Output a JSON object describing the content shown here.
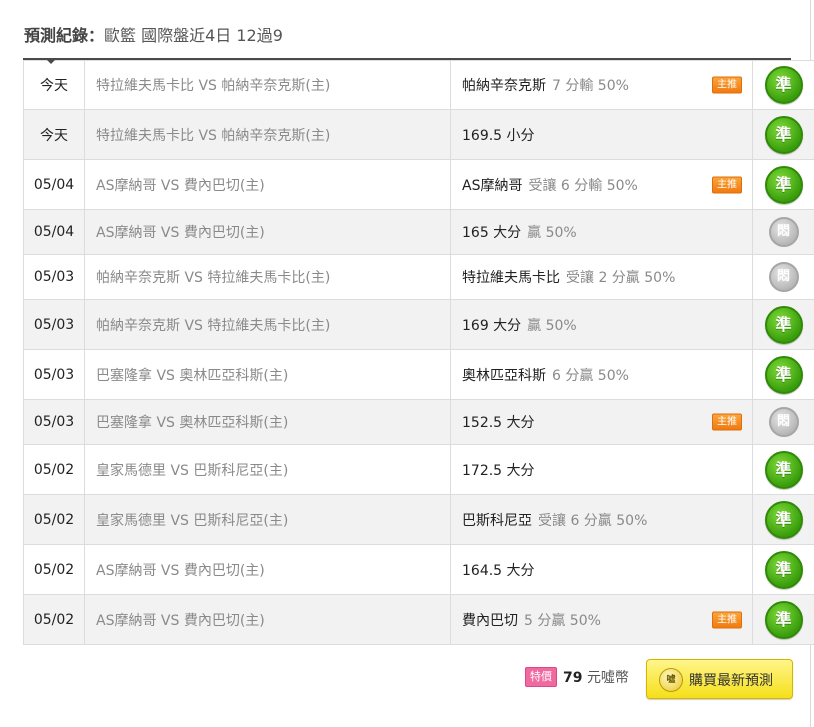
{
  "header": {
    "title": "預測紀錄：",
    "subtitle": "歐籃 國際盤近4日 12過9"
  },
  "rows": [
    {
      "date": "今天",
      "match": "特拉維夫馬卡比 VS 帕納辛奈克斯(主)",
      "pick": "帕納辛奈克斯",
      "odds": "7 分輸 50%",
      "badge": "主推",
      "result": "準",
      "result_type": "win"
    },
    {
      "date": "今天",
      "match": "特拉維夫馬卡比 VS 帕納辛奈克斯(主)",
      "pick": "169.5 小分",
      "odds": "",
      "badge": "",
      "result": "準",
      "result_type": "win"
    },
    {
      "date": "05/04",
      "match": "AS摩納哥 VS 費內巴切(主)",
      "pick": "AS摩納哥",
      "odds": "受讓 6 分輸 50%",
      "badge": "主推",
      "result": "準",
      "result_type": "win"
    },
    {
      "date": "05/04",
      "match": "AS摩納哥 VS 費內巴切(主)",
      "pick": "165 大分",
      "odds": "贏 50%",
      "badge": "",
      "result": "悶",
      "result_type": "lose"
    },
    {
      "date": "05/03",
      "match": "帕納辛奈克斯 VS 特拉維夫馬卡比(主)",
      "pick": "特拉維夫馬卡比",
      "odds": "受讓 2 分贏 50%",
      "badge": "",
      "result": "悶",
      "result_type": "lose"
    },
    {
      "date": "05/03",
      "match": "帕納辛奈克斯 VS 特拉維夫馬卡比(主)",
      "pick": "169 大分",
      "odds": "贏 50%",
      "badge": "",
      "result": "準",
      "result_type": "win"
    },
    {
      "date": "05/03",
      "match": "巴塞隆拿 VS 奧林匹亞科斯(主)",
      "pick": "奧林匹亞科斯",
      "odds": "6 分贏 50%",
      "badge": "",
      "result": "準",
      "result_type": "win"
    },
    {
      "date": "05/03",
      "match": "巴塞隆拿 VS 奧林匹亞科斯(主)",
      "pick": "152.5 大分",
      "odds": "",
      "badge": "主推",
      "result": "悶",
      "result_type": "lose"
    },
    {
      "date": "05/02",
      "match": "皇家馬德里 VS 巴斯科尼亞(主)",
      "pick": "172.5 大分",
      "odds": "",
      "badge": "",
      "result": "準",
      "result_type": "win"
    },
    {
      "date": "05/02",
      "match": "皇家馬德里 VS 巴斯科尼亞(主)",
      "pick": "巴斯科尼亞",
      "odds": "受讓 6 分贏 50%",
      "badge": "",
      "result": "準",
      "result_type": "win"
    },
    {
      "date": "05/02",
      "match": "AS摩納哥 VS 費內巴切(主)",
      "pick": "164.5 大分",
      "odds": "",
      "badge": "",
      "result": "準",
      "result_type": "win"
    },
    {
      "date": "05/02",
      "match": "AS摩納哥 VS 費內巴切(主)",
      "pick": "費內巴切",
      "odds": "5 分贏 50%",
      "badge": "主推",
      "result": "準",
      "result_type": "win"
    }
  ],
  "footer": {
    "special_label": "特價",
    "price_value": "79",
    "price_unit": "元噓幣",
    "buy_icon_text": "噓",
    "buy_label": "購買最新預測"
  },
  "colors": {
    "win": "#3a9e0c",
    "lose": "#b5b5b5",
    "badge": "#f07a12",
    "button": "#f5df1a"
  }
}
